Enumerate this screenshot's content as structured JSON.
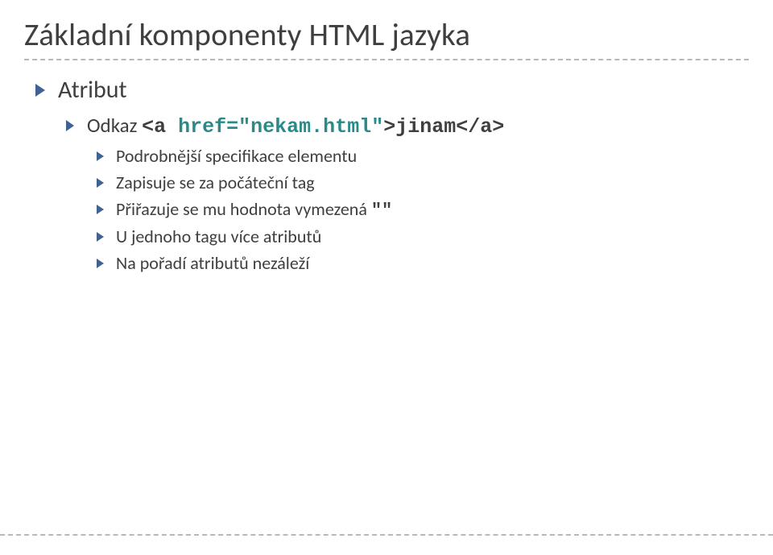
{
  "title": "Základní komponenty HTML jazyka",
  "b1": {
    "label": "Atribut"
  },
  "b2": {
    "prefix": "Odkaz ",
    "code1": "<a ",
    "highlight": "href=\"nekam.html\"",
    "code2": ">jinam</a>"
  },
  "b3": {
    "a": "Podrobnější specifikace elementu",
    "b": "Zapisuje se za počáteční tag",
    "c_pre": "Přiřazuje se mu hodnota vymezená ",
    "c_code": "\"\"",
    "d": "U jednoho tagu více atributů",
    "e": "Na pořadí atributů nezáleží"
  }
}
